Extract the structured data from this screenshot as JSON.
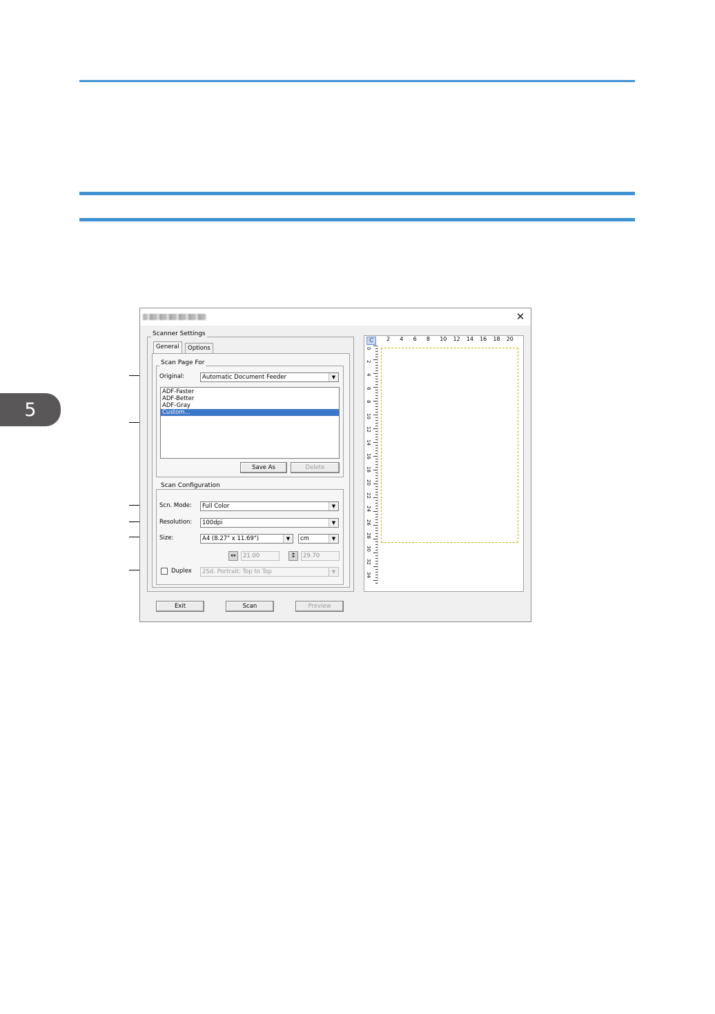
{
  "page": {
    "chapter_number": "5",
    "rule_color": "#3f93d3"
  },
  "dialog": {
    "close_label": "✕",
    "scanner_settings_label": "Scanner Settings",
    "tabs": [
      {
        "label": "General",
        "active": true
      },
      {
        "label": "Options",
        "active": false
      }
    ],
    "scan_page_for": {
      "label": "Scan Page For",
      "original_label": "Original:",
      "original_value": "Automatic Document Feeder",
      "presets": [
        {
          "label": "ADF-Faster",
          "selected": false
        },
        {
          "label": "ADF-Better",
          "selected": false
        },
        {
          "label": "ADF-Gray",
          "selected": false
        },
        {
          "label": "Custom...",
          "selected": true
        }
      ],
      "save_as_label": "Save As",
      "delete_label": "Delete"
    },
    "scan_configuration": {
      "label": "Scan Configuration",
      "scan_mode_label": "Scn. Mode:",
      "scan_mode_value": "Full Color",
      "resolution_label": "Resolution:",
      "resolution_value": "100dpi",
      "size_label": "Size:",
      "size_value": "A4 (8.27\" x 11.69\")",
      "unit_value": "cm",
      "width_value": "21.00",
      "height_value": "29.70",
      "duplex_label": "Duplex",
      "duplex_checked": false,
      "duplex_value": "2Sd. Portrait: Top to Top"
    },
    "buttons": {
      "exit_label": "Exit",
      "scan_label": "Scan",
      "preview_label": "Preview"
    },
    "preview": {
      "corner_label": "C",
      "top_ruler": [
        "2",
        "4",
        "6",
        "8",
        "10",
        "12",
        "14",
        "16",
        "18",
        "20"
      ],
      "left_ruler": [
        "0",
        "2",
        "4",
        "6",
        "8",
        "10",
        "12",
        "14",
        "16",
        "18",
        "20",
        "22",
        "24",
        "26",
        "28",
        "30",
        "32",
        "34"
      ],
      "scan_area_color": "#c8b400",
      "selection_color": "#3b76c8"
    }
  }
}
